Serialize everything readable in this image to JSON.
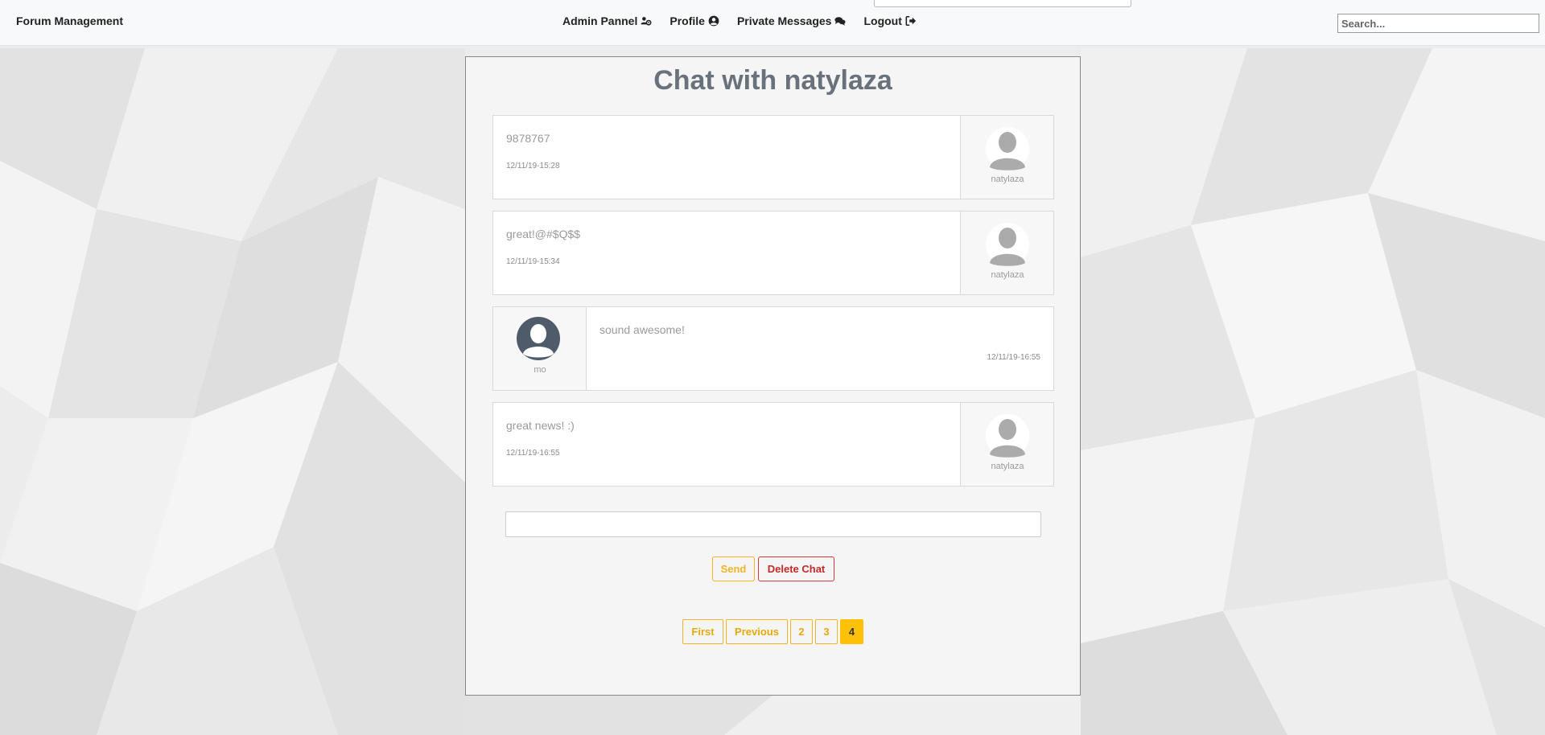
{
  "navbar": {
    "brand": "Forum Management",
    "links": [
      {
        "label": "Admin Pannel",
        "icon": "users-cog-icon"
      },
      {
        "label": "Profile",
        "icon": "user-circle-icon"
      },
      {
        "label": "Private Messages",
        "icon": "comments-icon"
      },
      {
        "label": "Logout",
        "icon": "sign-out-icon"
      }
    ],
    "search_placeholder": "Search..."
  },
  "chat": {
    "title": "Chat with natylaza",
    "messages": [
      {
        "side": "theirs",
        "text": "9878767",
        "time": "12/11/19-15:28",
        "user": "natylaza"
      },
      {
        "side": "theirs",
        "text": "great!@#$Q$$",
        "time": "12/11/19-15:34",
        "user": "natylaza"
      },
      {
        "side": "mine",
        "text": "sound awesome!",
        "time": "12/11/19-16:55",
        "user": "mo"
      },
      {
        "side": "theirs",
        "text": "great news! :)",
        "time": "12/11/19-16:55",
        "user": "natylaza"
      }
    ],
    "input_value": "",
    "send_label": "Send",
    "delete_label": "Delete Chat"
  },
  "pagination": {
    "first": "First",
    "previous": "Previous",
    "pages": [
      "2",
      "3",
      "4"
    ],
    "current": "4"
  },
  "colors": {
    "accent": "#ffc107",
    "danger": "#c62828",
    "title": "#68717c"
  }
}
